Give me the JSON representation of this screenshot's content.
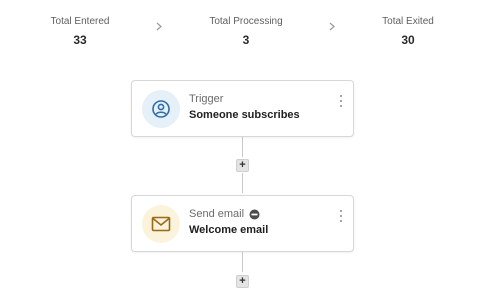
{
  "stats": {
    "entered": {
      "label": "Total Entered",
      "value": "33"
    },
    "processing": {
      "label": "Total Processing",
      "value": "3"
    },
    "exited": {
      "label": "Total Exited",
      "value": "30"
    }
  },
  "steps": [
    {
      "type_label": "Trigger",
      "name": "Someone subscribes",
      "icon": "user-circle-icon",
      "icon_bg": "#e6f0f8",
      "icon_color": "#2f6ea8"
    },
    {
      "type_label": "Send email",
      "name": "Welcome email",
      "icon": "envelope-icon",
      "status_icon": "status-icon",
      "icon_bg": "#fbf3dc",
      "icon_color": "#9a6a14"
    }
  ],
  "add_step_label": "+",
  "colors": {
    "card_border": "#d7d7d7",
    "connector": "#c9c9c9",
    "add_button_bg": "#e4e4e4"
  }
}
